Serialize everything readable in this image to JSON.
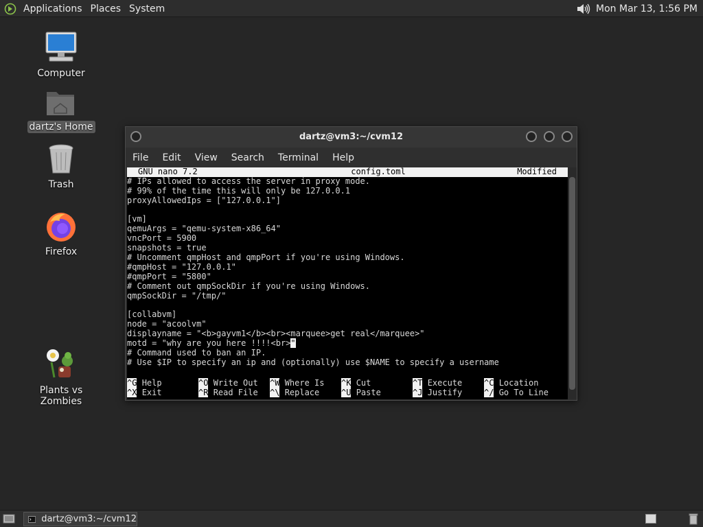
{
  "top_panel": {
    "menus": [
      "Applications",
      "Places",
      "System"
    ],
    "clock": "Mon Mar 13,  1:56 PM",
    "icons": [
      "distro-logo-icon",
      "volume-icon"
    ]
  },
  "desktop": {
    "icons": [
      {
        "label": "Computer",
        "icon": "computer-icon"
      },
      {
        "label": "dartz's Home",
        "icon": "home-folder-icon",
        "selected": true
      },
      {
        "label": "Trash",
        "icon": "trash-icon"
      },
      {
        "label": "Firefox",
        "icon": "firefox-icon"
      },
      {
        "label": "Plants vs Zombies",
        "icon": "plants-vs-zombies-icon"
      }
    ]
  },
  "window": {
    "title": "dartz@vm3:~/cvm12",
    "menu": [
      "File",
      "Edit",
      "View",
      "Search",
      "Terminal",
      "Help"
    ],
    "nano": {
      "version": "GNU nano 7.2",
      "filename": "config.toml",
      "status": "Modified"
    },
    "lines": [
      "# IPs allowed to access the server in proxy mode.",
      "# 99% of the time this will only be 127.0.0.1",
      "proxyAllowedIps = [\"127.0.0.1\"]",
      "",
      "[vm]",
      "qemuArgs = \"qemu-system-x86_64\"",
      "vncPort = 5900",
      "snapshots = true",
      "# Uncomment qmpHost and qmpPort if you're using Windows.",
      "#qmpHost = \"127.0.0.1\"",
      "#qmpPort = \"5800\"",
      "# Comment out qmpSockDir if you're using Windows.",
      "qmpSockDir = \"/tmp/\"",
      "",
      "[collabvm]",
      "node = \"acoolvm\"",
      "displayname = \"<b>gayvm1</b><br><marquee>get real</marquee>\"",
      "motd = \"why are you here !!!!<br>",
      "# Command used to ban an IP.",
      "# Use $IP to specify an ip and (optionally) use $NAME to specify a username"
    ],
    "cursor_char": "\"",
    "shortcuts": [
      [
        {
          "key": "^G",
          "label": "Help"
        },
        {
          "key": "^O",
          "label": "Write Out"
        },
        {
          "key": "^W",
          "label": "Where Is"
        },
        {
          "key": "^K",
          "label": "Cut"
        },
        {
          "key": "^T",
          "label": "Execute"
        },
        {
          "key": "^C",
          "label": "Location"
        }
      ],
      [
        {
          "key": "^X",
          "label": "Exit"
        },
        {
          "key": "^R",
          "label": "Read File"
        },
        {
          "key": "^\\",
          "label": "Replace"
        },
        {
          "key": "^U",
          "label": "Paste"
        },
        {
          "key": "^J",
          "label": "Justify"
        },
        {
          "key": "^/",
          "label": "Go To Line"
        }
      ]
    ]
  },
  "taskbar": {
    "task_label": "dartz@vm3:~/cvm12"
  }
}
